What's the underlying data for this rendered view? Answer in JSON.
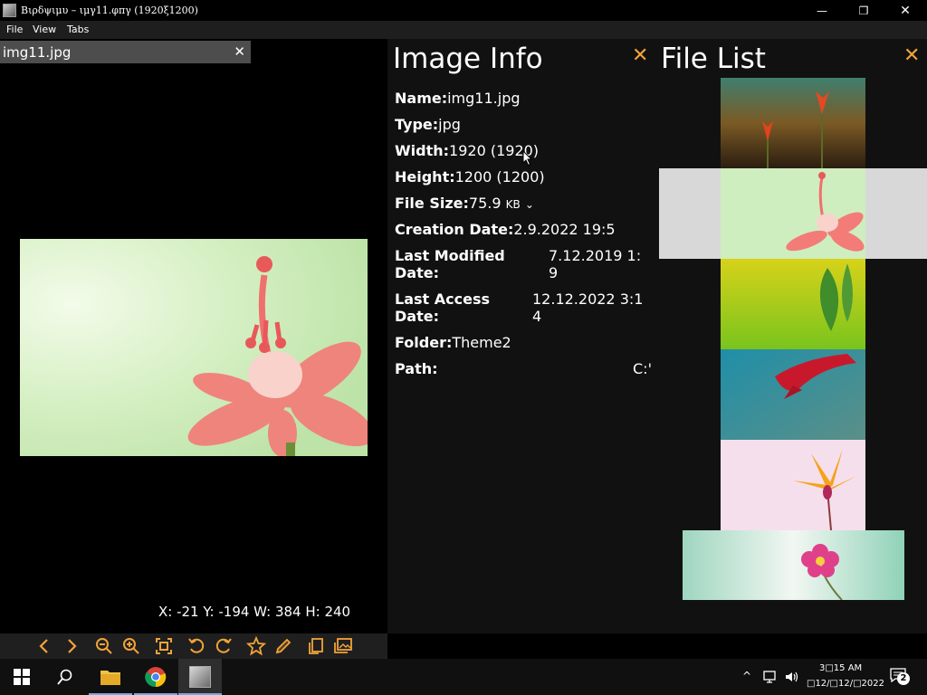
{
  "window": {
    "title": "Βιρδψιμυ – ιμγ11.φπγ (1920ξ1200)",
    "minimize": "—",
    "maximize": "❐",
    "close": "✕"
  },
  "menu": [
    "File",
    "View",
    "Tabs"
  ],
  "tab": {
    "label": "img11.jpg",
    "close": "✕"
  },
  "viewer": {
    "coords": "X: -21 Y: -194 W: 384 H: 240"
  },
  "toolbar": {
    "accent": "#f2a33a",
    "icons": [
      "chevron-left-icon",
      "chevron-right-icon",
      "zoom-out-icon",
      "zoom-in-icon",
      "fit-screen-icon",
      "rotate-left-icon",
      "rotate-right-icon",
      "star-icon",
      "edit-icon",
      "copy-icon",
      "gallery-icon"
    ]
  },
  "info": {
    "title": "Image Info",
    "close": "✕",
    "name_label": "Name:",
    "name_value": "img11.jpg",
    "type_label": "Type:",
    "type_value": "jpg",
    "width_label": "Width:",
    "width_value": "1920 (1920)",
    "height_label": "Height:",
    "height_value": "1200 (1200)",
    "size_label": "File Size:",
    "size_value": "75.9",
    "size_unit": "KB",
    "created_label": "Creation Date:",
    "created_value": "2.9.2022 19:5",
    "modified_label_1": "Last Modified",
    "modified_label_2": "Date:",
    "modified_value_1": "7.12.2019 1:",
    "modified_value_2": "9",
    "access_label_1": "Last Access",
    "access_label_2": "Date:",
    "access_value_1": "12.12.2022 3:1",
    "access_value_2": "4",
    "folder_label": "Folder:",
    "folder_value": "Theme2",
    "path_label": "Path:",
    "path_value": "C:'"
  },
  "file_list": {
    "title": "File List",
    "close": "✕",
    "selected_index": 1
  },
  "taskbar": {
    "time": "3□15 AM",
    "date": "□12/□12/□2022",
    "notifications": "2"
  }
}
